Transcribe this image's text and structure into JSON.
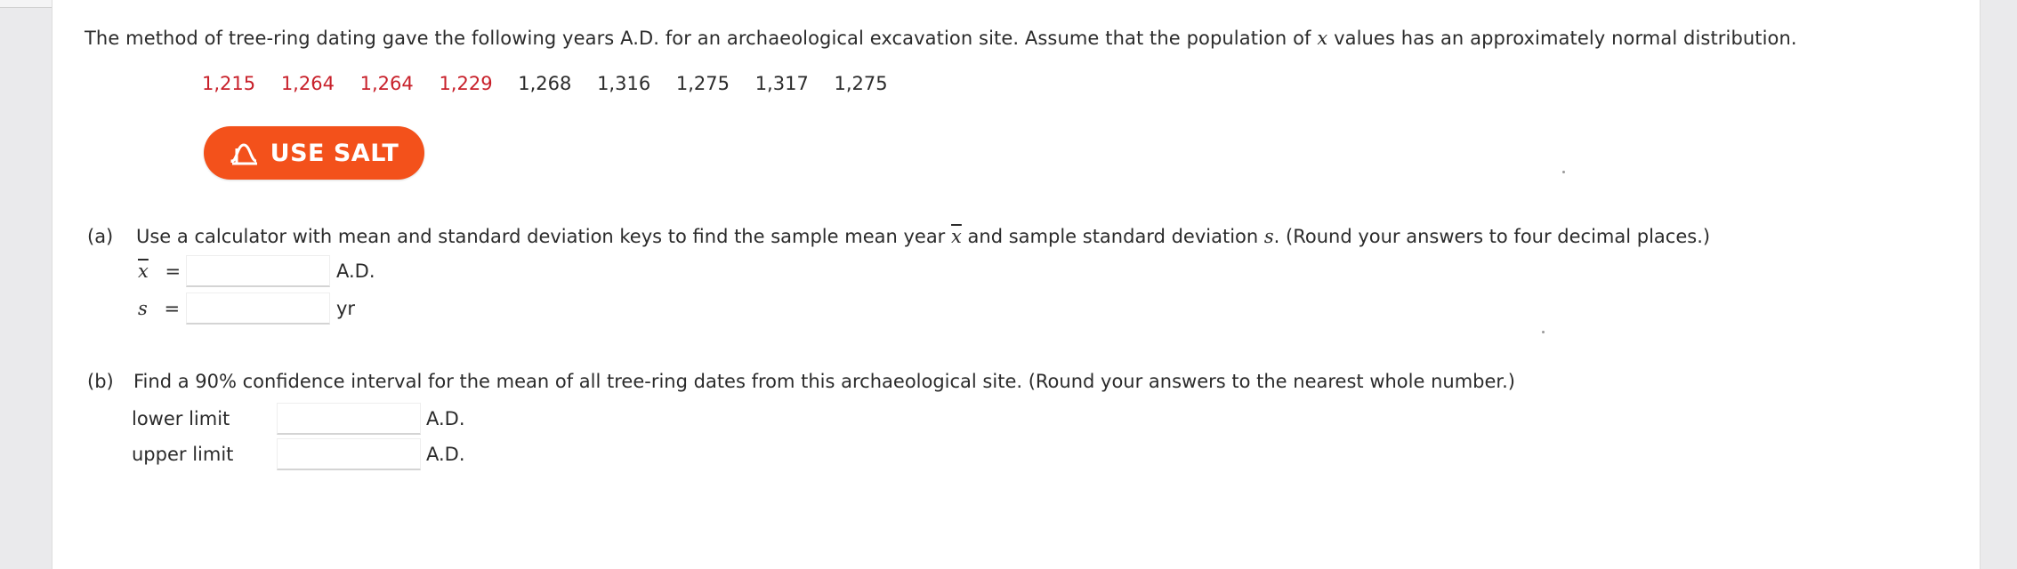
{
  "question": {
    "intro": "The method of tree-ring dating gave the following years A.D. for an archaeological excavation site. Assume that the population of",
    "var": "x",
    "intro_tail": "values has an approximately normal distribution."
  },
  "data_values": [
    {
      "text": "1,215",
      "color": "#c8202a"
    },
    {
      "text": "1,264",
      "color": "#c8202a"
    },
    {
      "text": "1,264",
      "color": "#c8202a"
    },
    {
      "text": "1,229",
      "color": "#c8202a"
    },
    {
      "text": "1,268",
      "color": "#2b2b2b"
    },
    {
      "text": "1,316",
      "color": "#2b2b2b"
    },
    {
      "text": "1,275",
      "color": "#2b2b2b"
    },
    {
      "text": "1,317",
      "color": "#2b2b2b"
    },
    {
      "text": "1,275",
      "color": "#2b2b2b"
    }
  ],
  "salt_button": {
    "label": "USE SALT",
    "icon": "salt-curve-icon",
    "color": "#f3511b"
  },
  "part_a": {
    "label": "(a)",
    "text_start": "Use a calculator with mean and standard deviation keys to find the sample mean year",
    "var_x": "x",
    "text_mid": "and sample standard deviation",
    "var_s": "s",
    "text_end": ". (Round your answers to four decimal places.)",
    "rows": [
      {
        "label_var": "x",
        "eq": "=",
        "value": "",
        "unit": "A.D."
      },
      {
        "label_var": "s",
        "eq": "=",
        "value": "",
        "unit": "yr"
      }
    ]
  },
  "part_b": {
    "label": "(b)",
    "text": "Find a 90% confidence interval for the mean of all tree-ring dates from this archaeological site. (Round your answers to the nearest whole number.)",
    "rows": [
      {
        "label": "lower limit",
        "value": "",
        "unit": "A.D."
      },
      {
        "label": "upper limit",
        "value": "",
        "unit": "A.D."
      }
    ]
  }
}
